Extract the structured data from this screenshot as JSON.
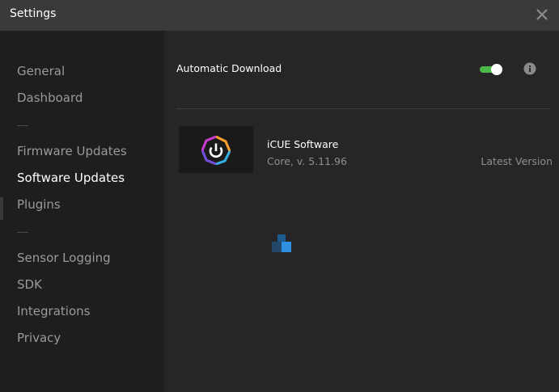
{
  "window": {
    "title": "Settings",
    "close_icon": "close-icon"
  },
  "sidebar": {
    "items": [
      {
        "label": "General",
        "active": false
      },
      {
        "label": "Dashboard",
        "active": false
      },
      {
        "label": "Firmware Updates",
        "active": false
      },
      {
        "label": "Software Updates",
        "active": true
      },
      {
        "label": "Plugins",
        "active": false
      },
      {
        "label": "Sensor Logging",
        "active": false
      },
      {
        "label": "SDK",
        "active": false
      },
      {
        "label": "Integrations",
        "active": false
      },
      {
        "label": "Privacy",
        "active": false
      }
    ]
  },
  "main": {
    "automatic_download": {
      "label": "Automatic Download",
      "enabled": true,
      "info_icon": "info-icon"
    },
    "software": {
      "name": "iCUE Software",
      "version": "Core, v. 5.11.96",
      "status": "Latest Version",
      "logo_icon": "icue-logo-icon"
    },
    "loading_icon": "loading-spinner-icon"
  },
  "colors": {
    "titlebar": "#3a3a3a",
    "sidebar": "#1e1e1e",
    "content": "#262626",
    "toggle_on": "#4cb84a",
    "spinner": "#2f8fe0"
  }
}
